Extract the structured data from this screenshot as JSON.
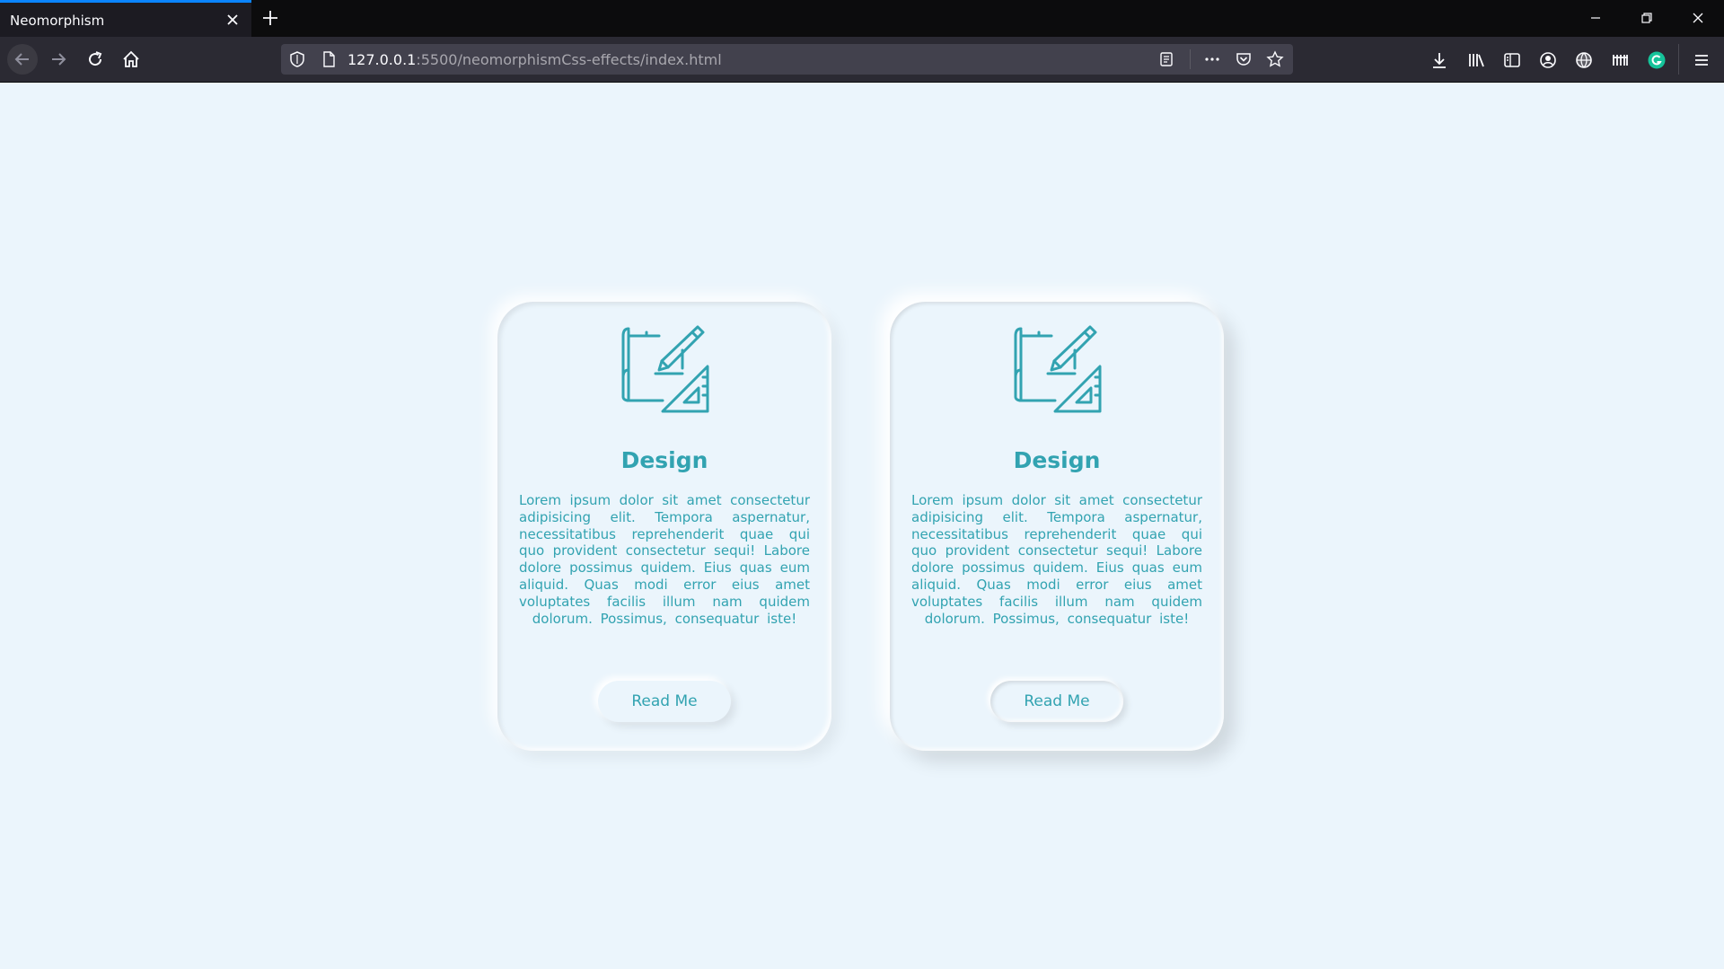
{
  "browser": {
    "tab_title": "Neomorphism",
    "url_host": "127.0.0.1",
    "url_rest": ":5500/neomorphismCss-effects/index.html",
    "accent": "#0a84ff"
  },
  "icons": {
    "nav": [
      "back-icon",
      "forward-icon",
      "reload-icon",
      "home-icon"
    ],
    "urlbar": [
      "shield-icon",
      "page-icon",
      "reader-view-icon",
      "more-icon",
      "pocket-icon",
      "bookmark-star-icon"
    ],
    "toolbar": [
      "download-icon",
      "library-icon",
      "sidebar-icon",
      "account-icon",
      "globe-icon",
      "extension-icon",
      "grammarly-icon",
      "menu-icon"
    ],
    "card": "design-blueprint-icon"
  },
  "colors": {
    "page_background": "#ebf5fc",
    "accent_teal": "#32a3b1"
  },
  "cards": [
    {
      "title": "Design",
      "text": "Lorem ipsum dolor sit amet consectetur adipisicing elit. Tempora aspernatur, necessitatibus reprehenderit quae qui quo provident consectetur sequi! Labore dolore possimus quidem. Eius quas eum aliquid. Quas modi error eius amet voluptates facilis illum nam quidem dolorum. Possimus, consequatur iste!",
      "button_label": "Read Me"
    },
    {
      "title": "Design",
      "text": "Lorem ipsum dolor sit amet consectetur adipisicing elit. Tempora aspernatur, necessitatibus reprehenderit quae qui quo provident consectetur sequi! Labore dolore possimus quidem. Eius quas eum aliquid. Quas modi error eius amet voluptates facilis illum nam quidem dolorum. Possimus, consequatur iste!",
      "button_label": "Read Me"
    }
  ]
}
